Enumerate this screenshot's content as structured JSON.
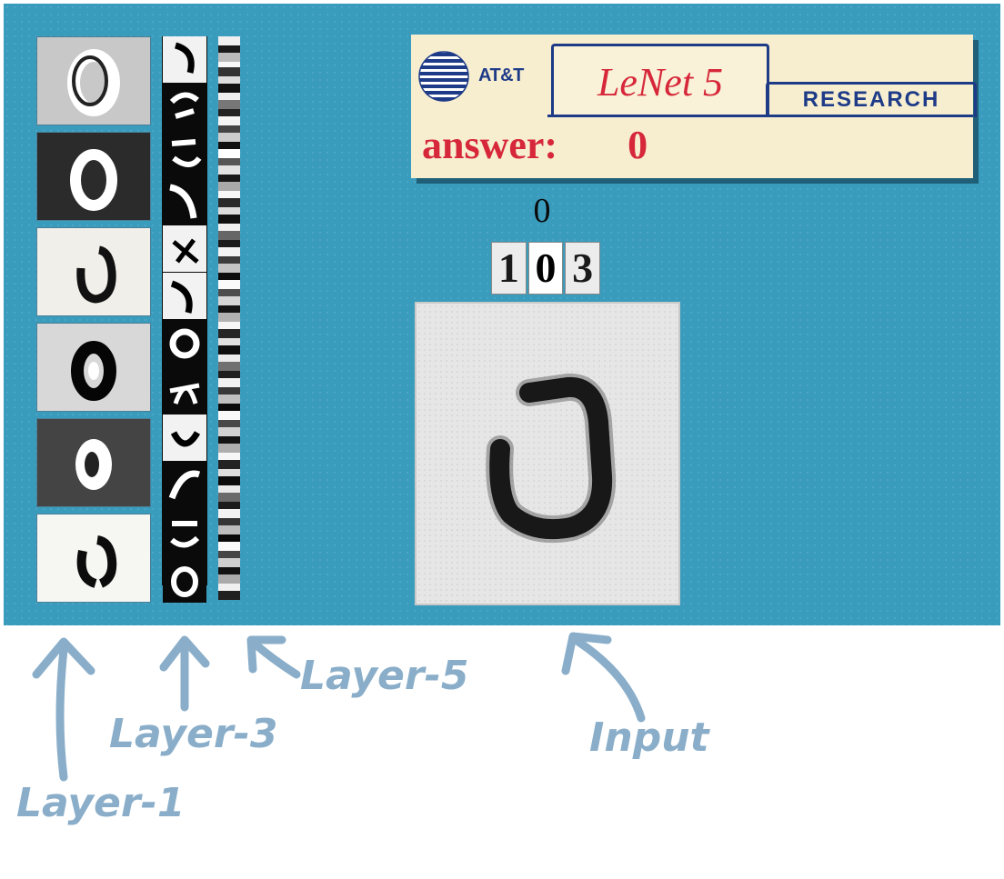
{
  "banner": {
    "logo_text": "AT&T",
    "title": "LeNet 5",
    "research_tab": "RESEARCH",
    "answer_label": "answer:",
    "answer_value": "0"
  },
  "prediction": {
    "top_digit": "0",
    "candidates": [
      "1",
      "0",
      "3"
    ],
    "selected_index": 1
  },
  "layers": {
    "layer1": {
      "label": "Layer-1",
      "tile_count": 6,
      "tile_backgrounds": [
        "#c8c8c8",
        "#2b2b2b",
        "#f1efe9",
        "#d8d8d8",
        "#444444",
        "#f6f6f3"
      ]
    },
    "layer3": {
      "label": "Layer-3",
      "cell_count": 12
    },
    "layer5": {
      "label": "Layer-5"
    },
    "input": {
      "label": "Input"
    }
  },
  "colors": {
    "screen_bg": "#3a9cbd",
    "banner_bg": "#f7eed0",
    "accent_red": "#d6283a",
    "brand_blue": "#1e3b88",
    "caption": "#8aaec9"
  },
  "icons": {
    "logo": "att-globe-icon",
    "arrows": "arrow-up-icon"
  }
}
